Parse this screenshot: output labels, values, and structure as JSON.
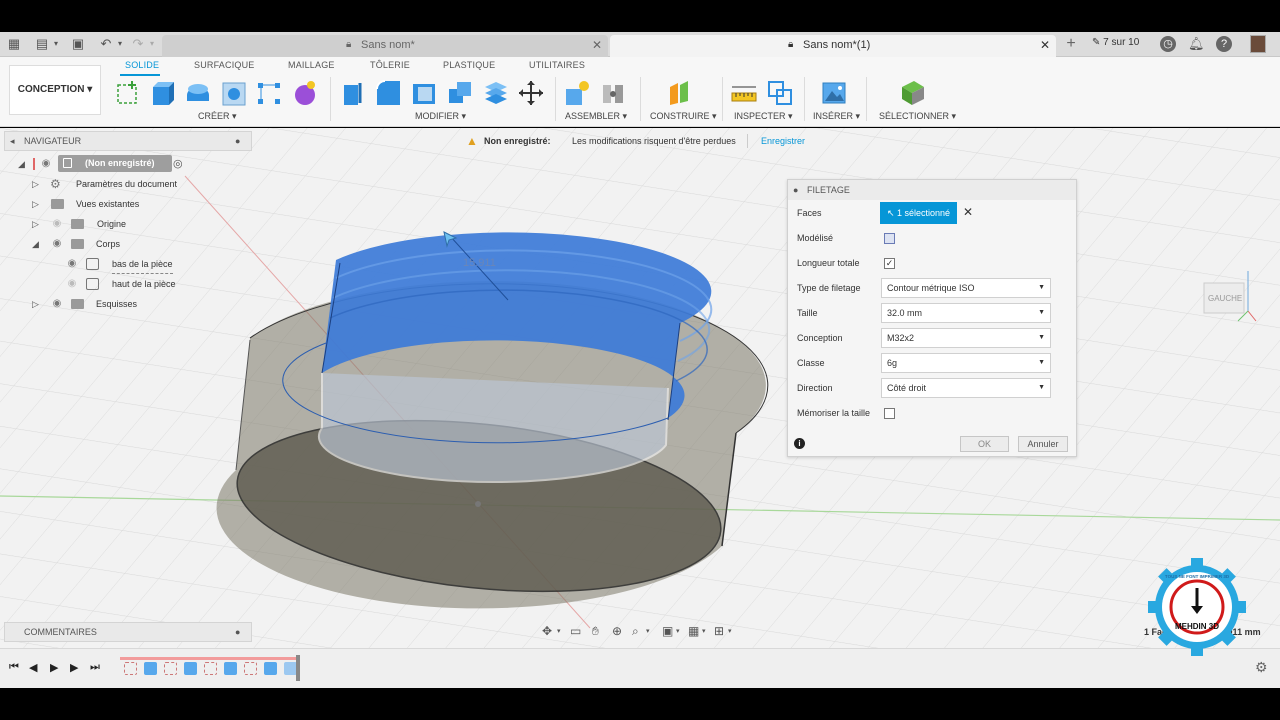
{
  "tabs": {
    "doc1": "Sans nom*",
    "doc2": "Sans nom*(1)",
    "version": "7 sur 10"
  },
  "toolbar": {
    "workspace": "CONCEPTION",
    "tabs": [
      "SOLIDE",
      "SURFACIQUE",
      "MAILLAGE",
      "TÔLERIE",
      "PLASTIQUE",
      "UTILITAIRES"
    ],
    "groups": [
      "CRÉER",
      "MODIFIER",
      "ASSEMBLER",
      "CONSTRUIRE",
      "INSPECTER",
      "INSÉRER",
      "SÉLECTIONNER"
    ]
  },
  "navigator": {
    "title": "NAVIGATEUR",
    "root": "(Non enregistré)",
    "items": [
      "Paramètres du document",
      "Vues existantes",
      "Origine",
      "Corps",
      "bas de la pièce",
      "haut de la pièce",
      "Esquisses"
    ]
  },
  "warning": {
    "title": "Non enregistré:",
    "message": "Les modifications risquent d'être perdues",
    "action": "Enregistrer"
  },
  "dialog": {
    "title": "FILETAGE",
    "faces_label": "Faces",
    "faces_value": "1 sélectionné",
    "modelise_label": "Modélisé",
    "modelise_checked": false,
    "longueur_label": "Longueur totale",
    "longueur_checked": true,
    "type_label": "Type de filetage",
    "type_value": "Contour métrique ISO",
    "taille_label": "Taille",
    "taille_value": "32.0 mm",
    "conception_label": "Conception",
    "conception_value": "M32x2",
    "classe_label": "Classe",
    "classe_value": "6g",
    "direction_label": "Direction",
    "direction_value": "Côté droit",
    "memoriser_label": "Mémoriser la taille",
    "memoriser_checked": false,
    "ok": "OK",
    "cancel": "Annuler"
  },
  "viewport": {
    "dimension": "15.911",
    "viewcube_label": "GAUCHE",
    "status": "1 Face | Rayon : 15.911 mm"
  },
  "comments": {
    "title": "COMMENTAIRES"
  },
  "logo": {
    "ring_text": "TOUS NE FONT IMPRIMER 3D",
    "name": "MEHDIN 3D"
  },
  "colors": {
    "accent": "#0696d7",
    "selection_blue": "#3d7bd8",
    "body_grey": "#6f6f66"
  }
}
